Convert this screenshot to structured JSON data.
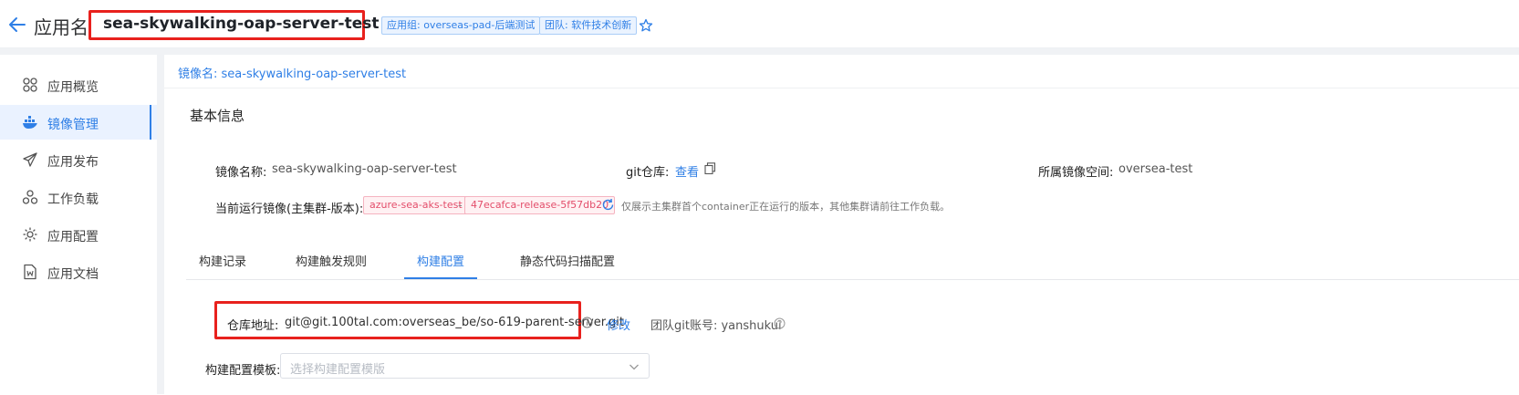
{
  "header": {
    "app_label": "应用名",
    "app_name": "sea-skywalking-oap-server-test",
    "tag_group": "应用组: overseas-pad-后端测试",
    "tag_team": "团队: 软件技术创新"
  },
  "sidebar": {
    "items": [
      {
        "label": "应用概览",
        "icon": "overview-icon"
      },
      {
        "label": "镜像管理",
        "icon": "docker-icon",
        "active": true
      },
      {
        "label": "应用发布",
        "icon": "send-icon"
      },
      {
        "label": "工作负载",
        "icon": "workload-icon"
      },
      {
        "label": "应用配置",
        "icon": "settings-icon"
      },
      {
        "label": "应用文档",
        "icon": "document-icon"
      }
    ]
  },
  "main": {
    "image_tab": "镜像名: sea-skywalking-oap-server-test",
    "section_title": "基本信息",
    "image_name_label": "镜像名称:",
    "image_name_value": "sea-skywalking-oap-server-test",
    "git_label": "git仓库:",
    "git_link": "查看",
    "namespace_label": "所属镜像空间:",
    "namespace_value": "oversea-test",
    "running_label": "当前运行镜像(主集群-版本):",
    "cluster": "azure-sea-aks-test",
    "dash": "-",
    "version": "47ecafca-release-5f57db20",
    "hint": "仅展示主集群首个container正在运行的版本，其他集群请前往工作负载。"
  },
  "tabs": [
    "构建记录",
    "构建触发规则",
    "构建配置",
    "静态代码扫描配置"
  ],
  "active_tab": "构建配置",
  "build_config": {
    "repo_label": "仓库地址:",
    "repo_value": "git@git.100tal.com:overseas_be/so-619-parent-server.git",
    "edit": "修改",
    "team_git_account": "团队git账号: yanshukui",
    "template_label": "构建配置模板:",
    "template_placeholder": "选择构建配置模版"
  },
  "colors": {
    "accent": "#2f7fe6",
    "highlight": "#e8211d",
    "pill": "#e34d6a"
  }
}
